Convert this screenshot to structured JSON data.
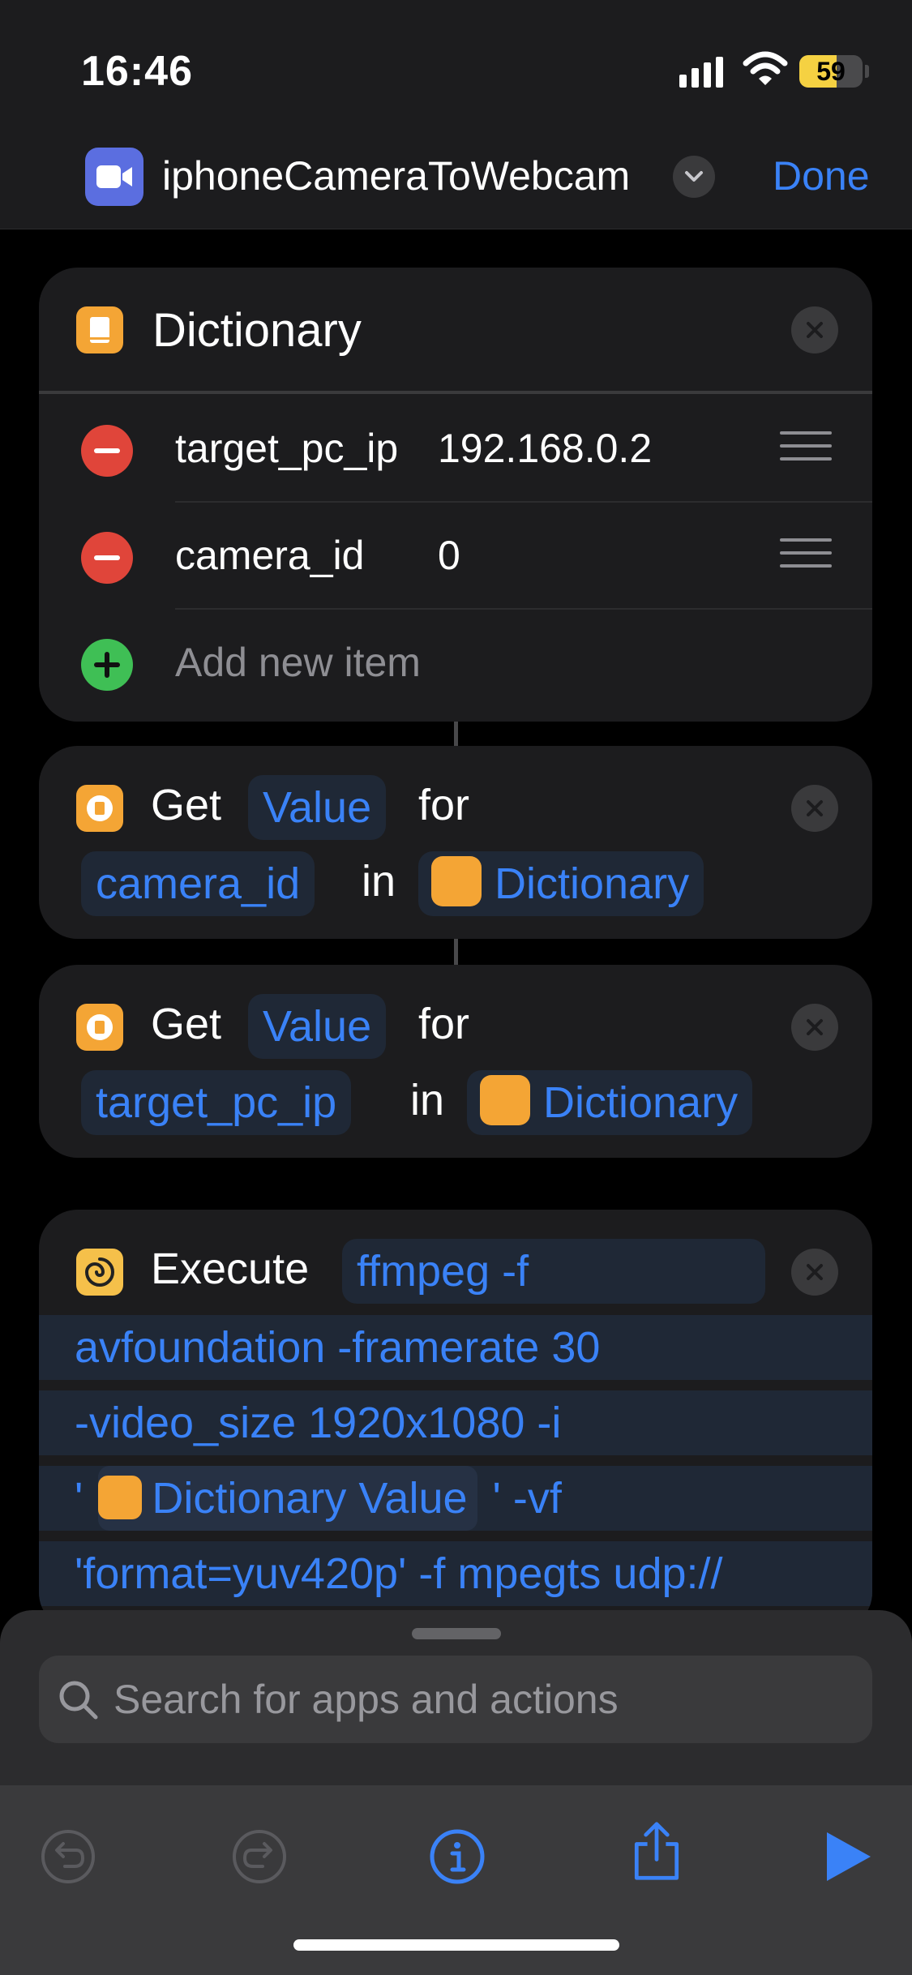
{
  "status": {
    "time": "16:46",
    "battery": "59",
    "battery_level": 59
  },
  "nav": {
    "title": "iphoneCameraToWebcam",
    "done_label": "Done"
  },
  "dictionary": {
    "title": "Dictionary",
    "items": [
      {
        "key": "target_pc_ip",
        "value": "192.168.0.2"
      },
      {
        "key": "camera_id",
        "value": "0"
      }
    ],
    "add_label": "Add new item"
  },
  "get_actions": [
    {
      "get": "Get",
      "value_token": "Value",
      "for": "for",
      "key_token": "camera_id",
      "in": "in",
      "dict_token": "Dictionary"
    },
    {
      "get": "Get",
      "value_token": "Value",
      "for": "for",
      "key_token": "target_pc_ip",
      "in": "in",
      "dict_token": "Dictionary"
    }
  ],
  "execute": {
    "label": "Execute",
    "line1": "ffmpeg -f",
    "line2": "avfoundation -framerate 30",
    "line3": "-video_size 1920x1080 -i",
    "line4_prefix": "'",
    "line4_token": "Dictionary Value",
    "line4_suffix": "' -vf",
    "line5": "'format=yuv420p' -f mpegts udp://"
  },
  "search": {
    "placeholder": "Search for apps and actions"
  },
  "toolbar": {
    "icons": [
      "undo-icon",
      "redo-icon",
      "info-icon",
      "share-icon",
      "play-icon"
    ]
  },
  "colors": {
    "accent": "#3a82f7",
    "card_bg": "#1c1c1e",
    "dictionary_icon": "#f4a535",
    "delete_red": "#e0453a",
    "add_green": "#3fbf55",
    "battery_yellow": "#f5d142"
  }
}
